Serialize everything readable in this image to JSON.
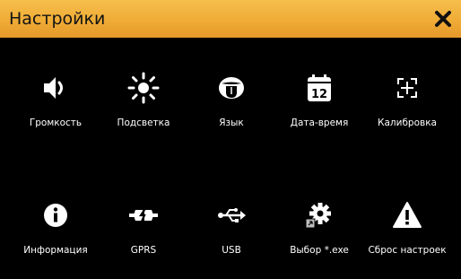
{
  "window": {
    "title": "Настройки",
    "close_icon": "close-icon"
  },
  "colors": {
    "titlebar_top": "#f6be4d",
    "titlebar_bottom": "#e6982a",
    "background": "#000000",
    "icon": "#ffffff",
    "label": "#ffffff"
  },
  "tiles": [
    {
      "label": "Громкость",
      "icon": "speaker-volume-icon"
    },
    {
      "label": "Подсветка",
      "icon": "backlight-sun-icon"
    },
    {
      "label": "Язык",
      "icon": "language-mouth-icon"
    },
    {
      "label": "Дата-время",
      "icon": "calendar-icon",
      "icon_text": "12"
    },
    {
      "label": "Калибровка",
      "icon": "calibration-crosshair-icon"
    },
    {
      "label": "Информация",
      "icon": "info-icon"
    },
    {
      "label": "GPRS",
      "icon": "gprs-connection-icon"
    },
    {
      "label": "USB",
      "icon": "usb-icon"
    },
    {
      "label": "Выбор *.exe",
      "icon": "exe-gear-icon"
    },
    {
      "label": "Сброс настроек",
      "icon": "warning-triangle-icon"
    }
  ]
}
